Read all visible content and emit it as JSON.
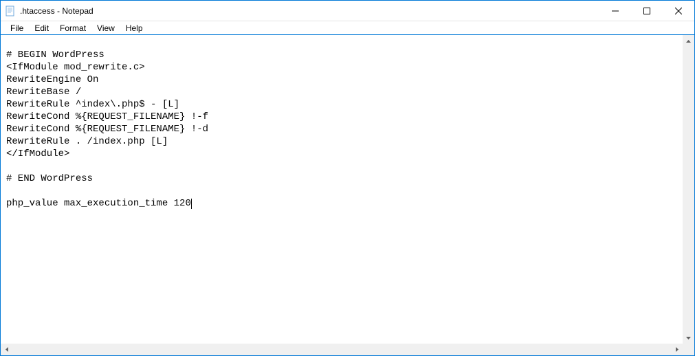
{
  "window": {
    "title": ".htaccess - Notepad"
  },
  "menu": {
    "file": "File",
    "edit": "Edit",
    "format": "Format",
    "view": "View",
    "help": "Help"
  },
  "editor": {
    "content": "\n# BEGIN WordPress\n<IfModule mod_rewrite.c>\nRewriteEngine On\nRewriteBase /\nRewriteRule ^index\\.php$ - [L]\nRewriteCond %{REQUEST_FILENAME} !-f\nRewriteCond %{REQUEST_FILENAME} !-d\nRewriteRule . /index.php [L]\n</IfModule>\n\n# END WordPress\n\nphp_value max_execution_time 120"
  }
}
